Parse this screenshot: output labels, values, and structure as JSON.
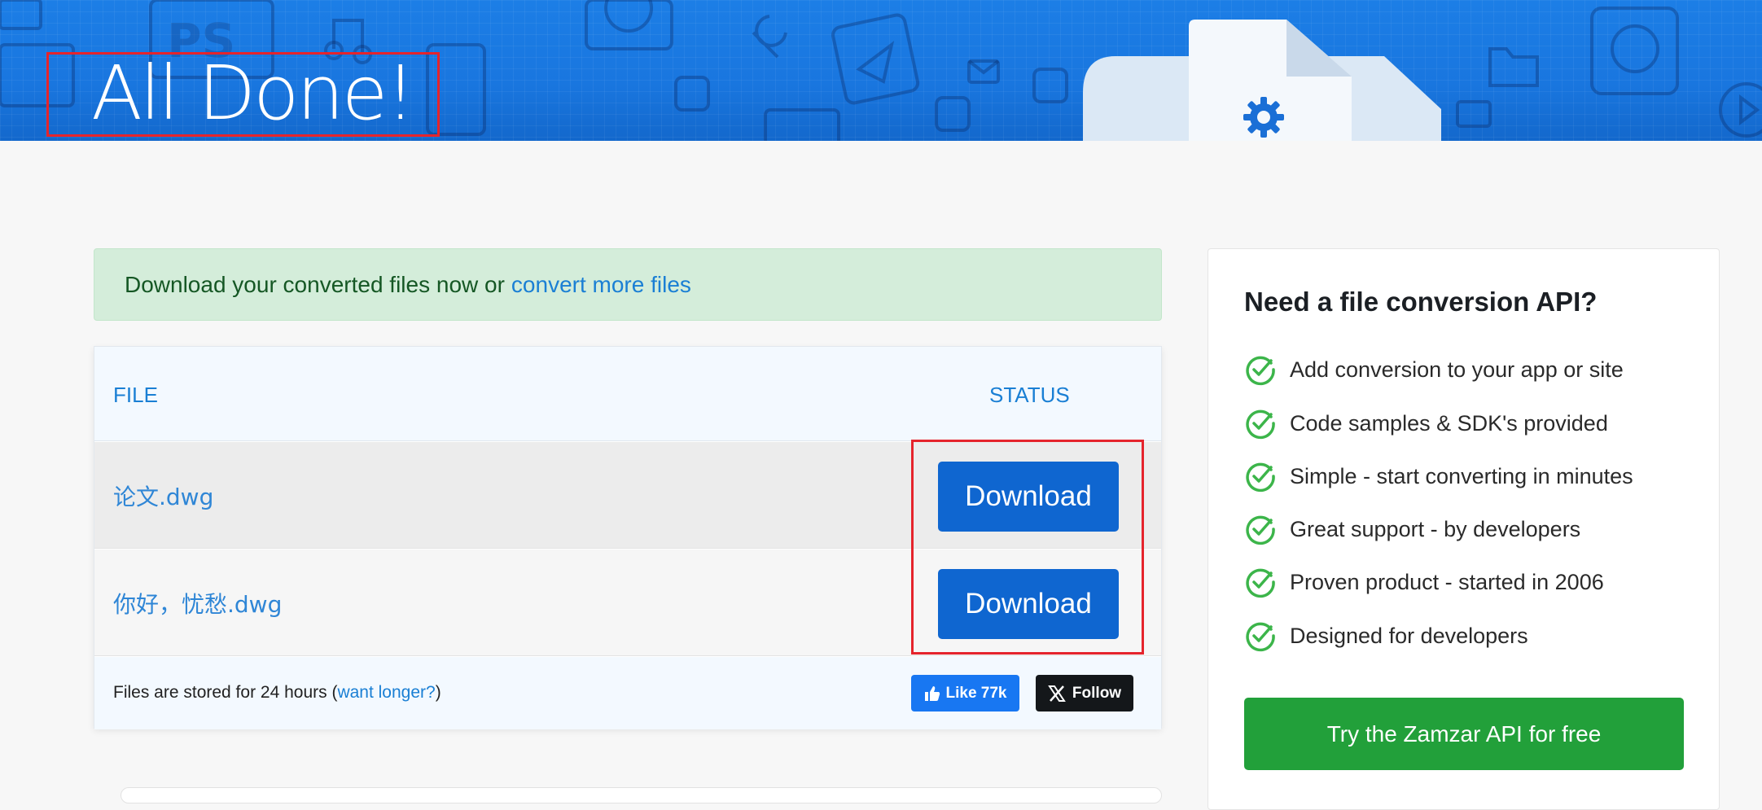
{
  "hero": {
    "title": "All Done!"
  },
  "alert": {
    "text": "Download your converted files now or",
    "link": "convert more files"
  },
  "files_table": {
    "headers": {
      "file": "FILE",
      "status": "STATUS"
    },
    "rows": [
      {
        "filename": "论文.dwg",
        "action": "Download"
      },
      {
        "filename": "你好，忧愁.dwg",
        "action": "Download"
      }
    ],
    "footer": {
      "note_prefix": "Files are stored for 24 hours (",
      "note_link": "want longer?",
      "note_suffix": ")",
      "like_label": "Like 77k",
      "follow_label": "Follow"
    }
  },
  "api_card": {
    "title": "Need a file conversion API?",
    "features": [
      "Add conversion to your app or site",
      "Code samples & SDK's provided",
      "Simple - start converting in minutes",
      "Great support - by developers",
      "Proven product - started in 2006",
      "Designed for developers"
    ],
    "button": "Try the Zamzar API for free"
  },
  "icons": {
    "feature_check": "check-circle-icon",
    "like": "thumbs-up-icon",
    "follow": "x-logo-icon",
    "hero_center": "gear-icon"
  },
  "colors": {
    "hero_blue": "#1976df",
    "link_blue": "#1a7fd4",
    "download_blue": "#0f66d0",
    "success_green": "#22a03a",
    "check_green": "#3cb54a",
    "alert_bg": "#d4edda",
    "highlight_red": "#e5242c"
  }
}
